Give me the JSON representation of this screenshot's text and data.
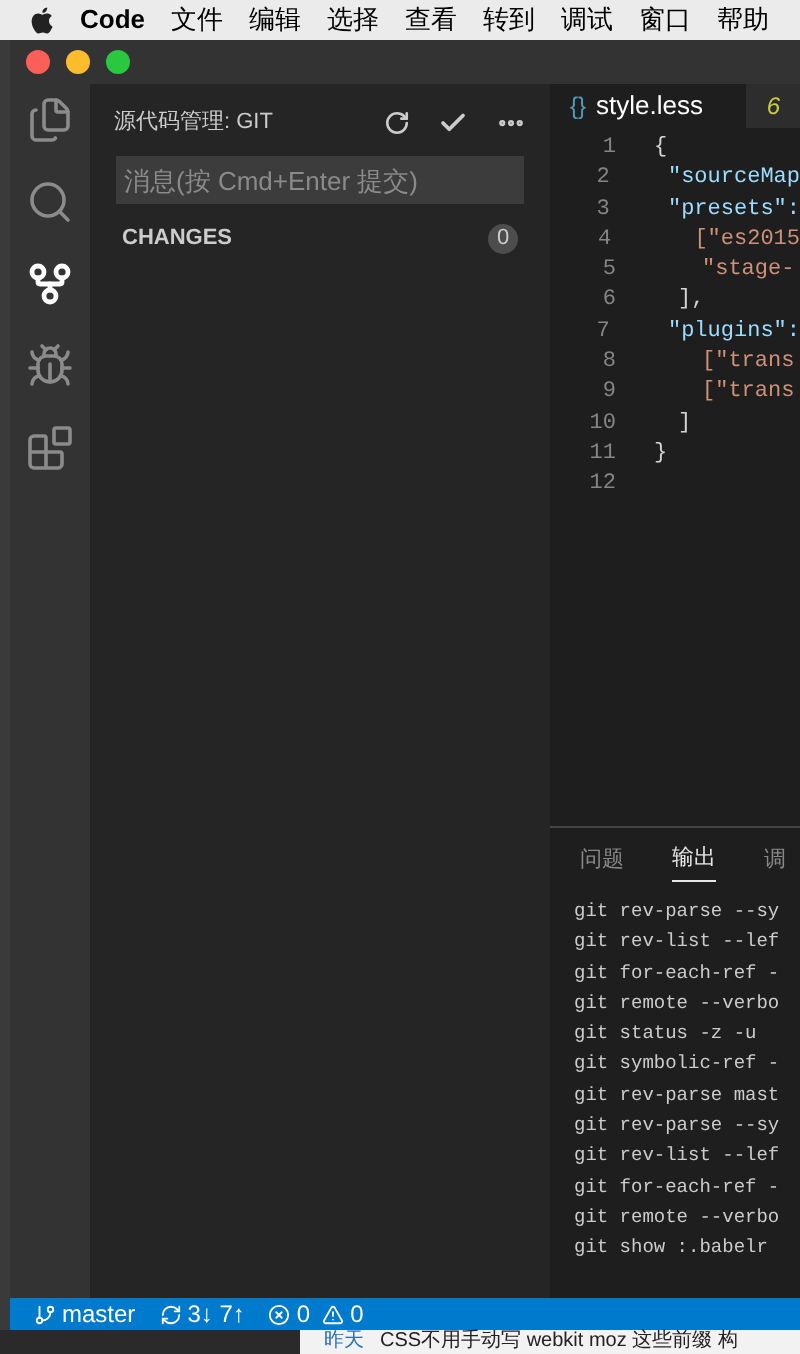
{
  "menu_bar": {
    "app": "Code",
    "items": [
      "文件",
      "编辑",
      "选择",
      "查看",
      "转到",
      "调试",
      "窗口",
      "帮助"
    ]
  },
  "activity_bar": [
    {
      "kind": "files",
      "selected": false
    },
    {
      "kind": "search",
      "selected": false
    },
    {
      "kind": "scm",
      "selected": true
    },
    {
      "kind": "debug",
      "selected": false
    },
    {
      "kind": "extensions",
      "selected": false
    }
  ],
  "sidebar": {
    "title": "源代码管理: GIT",
    "message": {
      "placeholder": "消息(按 Cmd+Enter 提交)"
    },
    "section": "CHANGES",
    "count": "0"
  },
  "editor": {
    "tabs": [
      {
        "icon": "{}",
        "label": "style.less",
        "selected": true
      },
      {
        "icon": "6",
        "selected": false
      }
    ],
    "lines": [
      {
        "number": "1",
        "text": "{"
      },
      {
        "number": "2",
        "text": "\"sourceMap"
      },
      {
        "number": "3",
        "text": "\"presets\":"
      },
      {
        "number": "4",
        "text": "[\"es2015"
      },
      {
        "number": "5",
        "text": "\"stage-"
      },
      {
        "number": "6",
        "text": "],"
      },
      {
        "number": "7",
        "text": "\"plugins\":"
      },
      {
        "number": "8",
        "text": "[\"trans"
      },
      {
        "number": "9",
        "text": "[\"trans"
      },
      {
        "number": "10",
        "text": "]"
      },
      {
        "number": "11",
        "text": "}"
      },
      {
        "number": "12"
      }
    ]
  },
  "panel": {
    "tabs": [
      {
        "label": "问题",
        "selected": false
      },
      {
        "label": "输出",
        "selected": true
      },
      {
        "label": "调",
        "selected": false
      }
    ],
    "output": [
      "git rev-parse --sy",
      "git rev-list --lef",
      "git for-each-ref -",
      "git remote --verbo",
      "git status -z -u",
      "git symbolic-ref -",
      "git rev-parse mast",
      "git rev-parse --sy",
      "git rev-list --lef",
      "git for-each-ref -",
      "git remote --verbo",
      "git show :.babelr"
    ]
  },
  "status_bar": {
    "branch": "master",
    "sync": "3↓ 7↑",
    "errors": "0",
    "warnings": "0"
  },
  "background": {
    "date": "昨天",
    "text": "CSS不用手动写 webkit moz 这些前缀 构"
  }
}
